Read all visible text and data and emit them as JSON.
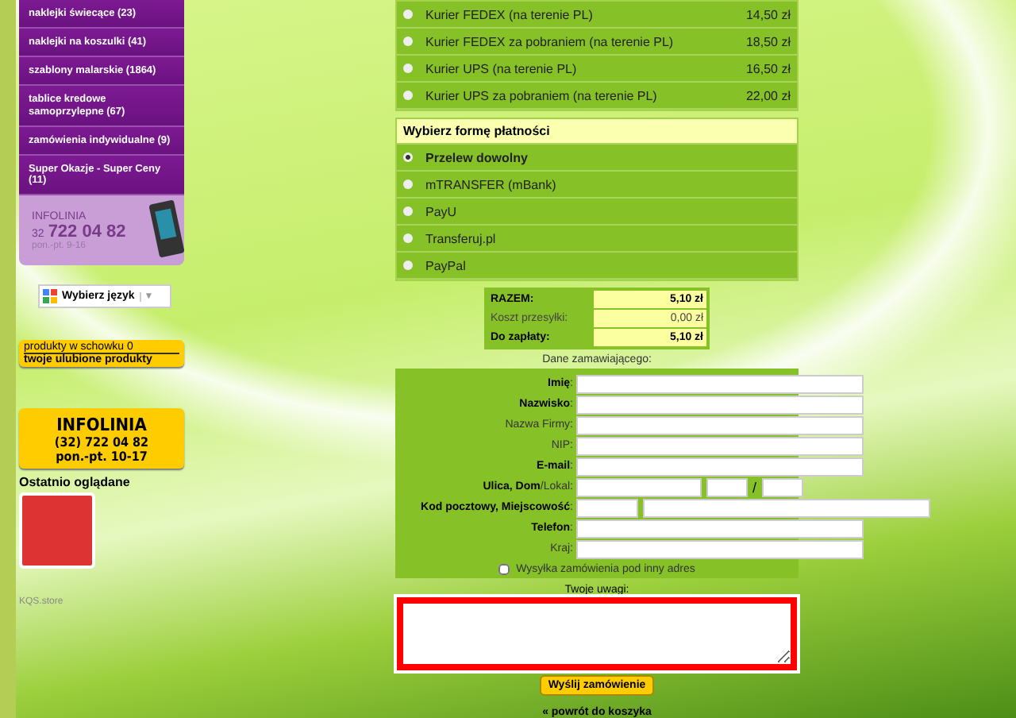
{
  "sidebar": {
    "categories": [
      {
        "label": "naklejki świecące (23)"
      },
      {
        "label": "naklejki na koszulki (41)"
      },
      {
        "label": "szablony malarskie (1864)"
      },
      {
        "label": "tablice kredowe samoprzylepne (67)"
      },
      {
        "label": "zamówienia indywidualne (9)"
      },
      {
        "label": "Super Okazje - Super Ceny (11)"
      }
    ],
    "hotline": {
      "title": "INFOLINIA",
      "prefix": "32",
      "number": "722 04 82",
      "hours": "pon.-pt. 9-16"
    },
    "language": {
      "label": "Wybierz język",
      "caret": "▼"
    },
    "clipboard": {
      "count_text": "produkty w schowku 0",
      "favorites": "twoje ulubione produkty"
    },
    "hotline_box": {
      "title": "INFOLINIA",
      "phone": "(32) 722 04 82",
      "hours": "pon.-pt. 10-17"
    },
    "recent": {
      "title": "Ostatnio oglądane"
    },
    "footer": "KQS.store"
  },
  "shipping": [
    {
      "label": "Kurier FEDEX (na terenie PL)",
      "price": "14,50 zł",
      "selected": false
    },
    {
      "label": "Kurier FEDEX za pobraniem (na terenie PL)",
      "price": "18,50 zł",
      "selected": false
    },
    {
      "label": "Kurier UPS (na terenie PL)",
      "price": "16,50 zł",
      "selected": false
    },
    {
      "label": "Kurier UPS za pobraniem (na terenie PL)",
      "price": "22,00 zł",
      "selected": false
    }
  ],
  "payment": {
    "title": "Wybierz formę płatności",
    "options": [
      {
        "label": "Przelew dowolny",
        "selected": true
      },
      {
        "label": "mTRANSFER (mBank)",
        "selected": false
      },
      {
        "label": "PayU",
        "selected": false
      },
      {
        "label": "Transferuj.pl",
        "selected": false
      },
      {
        "label": "PayPal",
        "selected": false
      }
    ]
  },
  "totals": [
    {
      "label": "RAZEM:",
      "value": "5,10 zł",
      "bold": true
    },
    {
      "label": "Koszt przesyłki:",
      "value": "0,00 zł",
      "bold": false
    },
    {
      "label": "Do zapłaty:",
      "value": "5,10 zł",
      "bold": true
    }
  ],
  "customer": {
    "title": "Dane zamawiającego:",
    "fields": [
      {
        "label": "**Imię**:",
        "kind": "single"
      },
      {
        "label": "**Nazwisko**:",
        "kind": "single"
      },
      {
        "label": "Nazwa Firmy:",
        "kind": "single"
      },
      {
        "label": "NIP:",
        "kind": "single"
      },
      {
        "label": "**E-mail**:",
        "kind": "single"
      },
      {
        "label": "**Ulica, Dom**/Lokal:",
        "kind": "address",
        "separator": "/"
      },
      {
        "label": "**Kod pocztowy, Miejscowość**:",
        "kind": "postal"
      },
      {
        "label": "**Telefon**:",
        "kind": "single"
      },
      {
        "label": "Kraj:",
        "kind": "single"
      }
    ],
    "other_address": {
      "label": "Wysyłka zamówienia pod inny adres",
      "checked": false
    }
  },
  "notes": {
    "label": "Twoje uwagi:",
    "highlighted": true
  },
  "submit": "Wyślij zamówienie",
  "back_link": "« powrót do koszyka"
}
